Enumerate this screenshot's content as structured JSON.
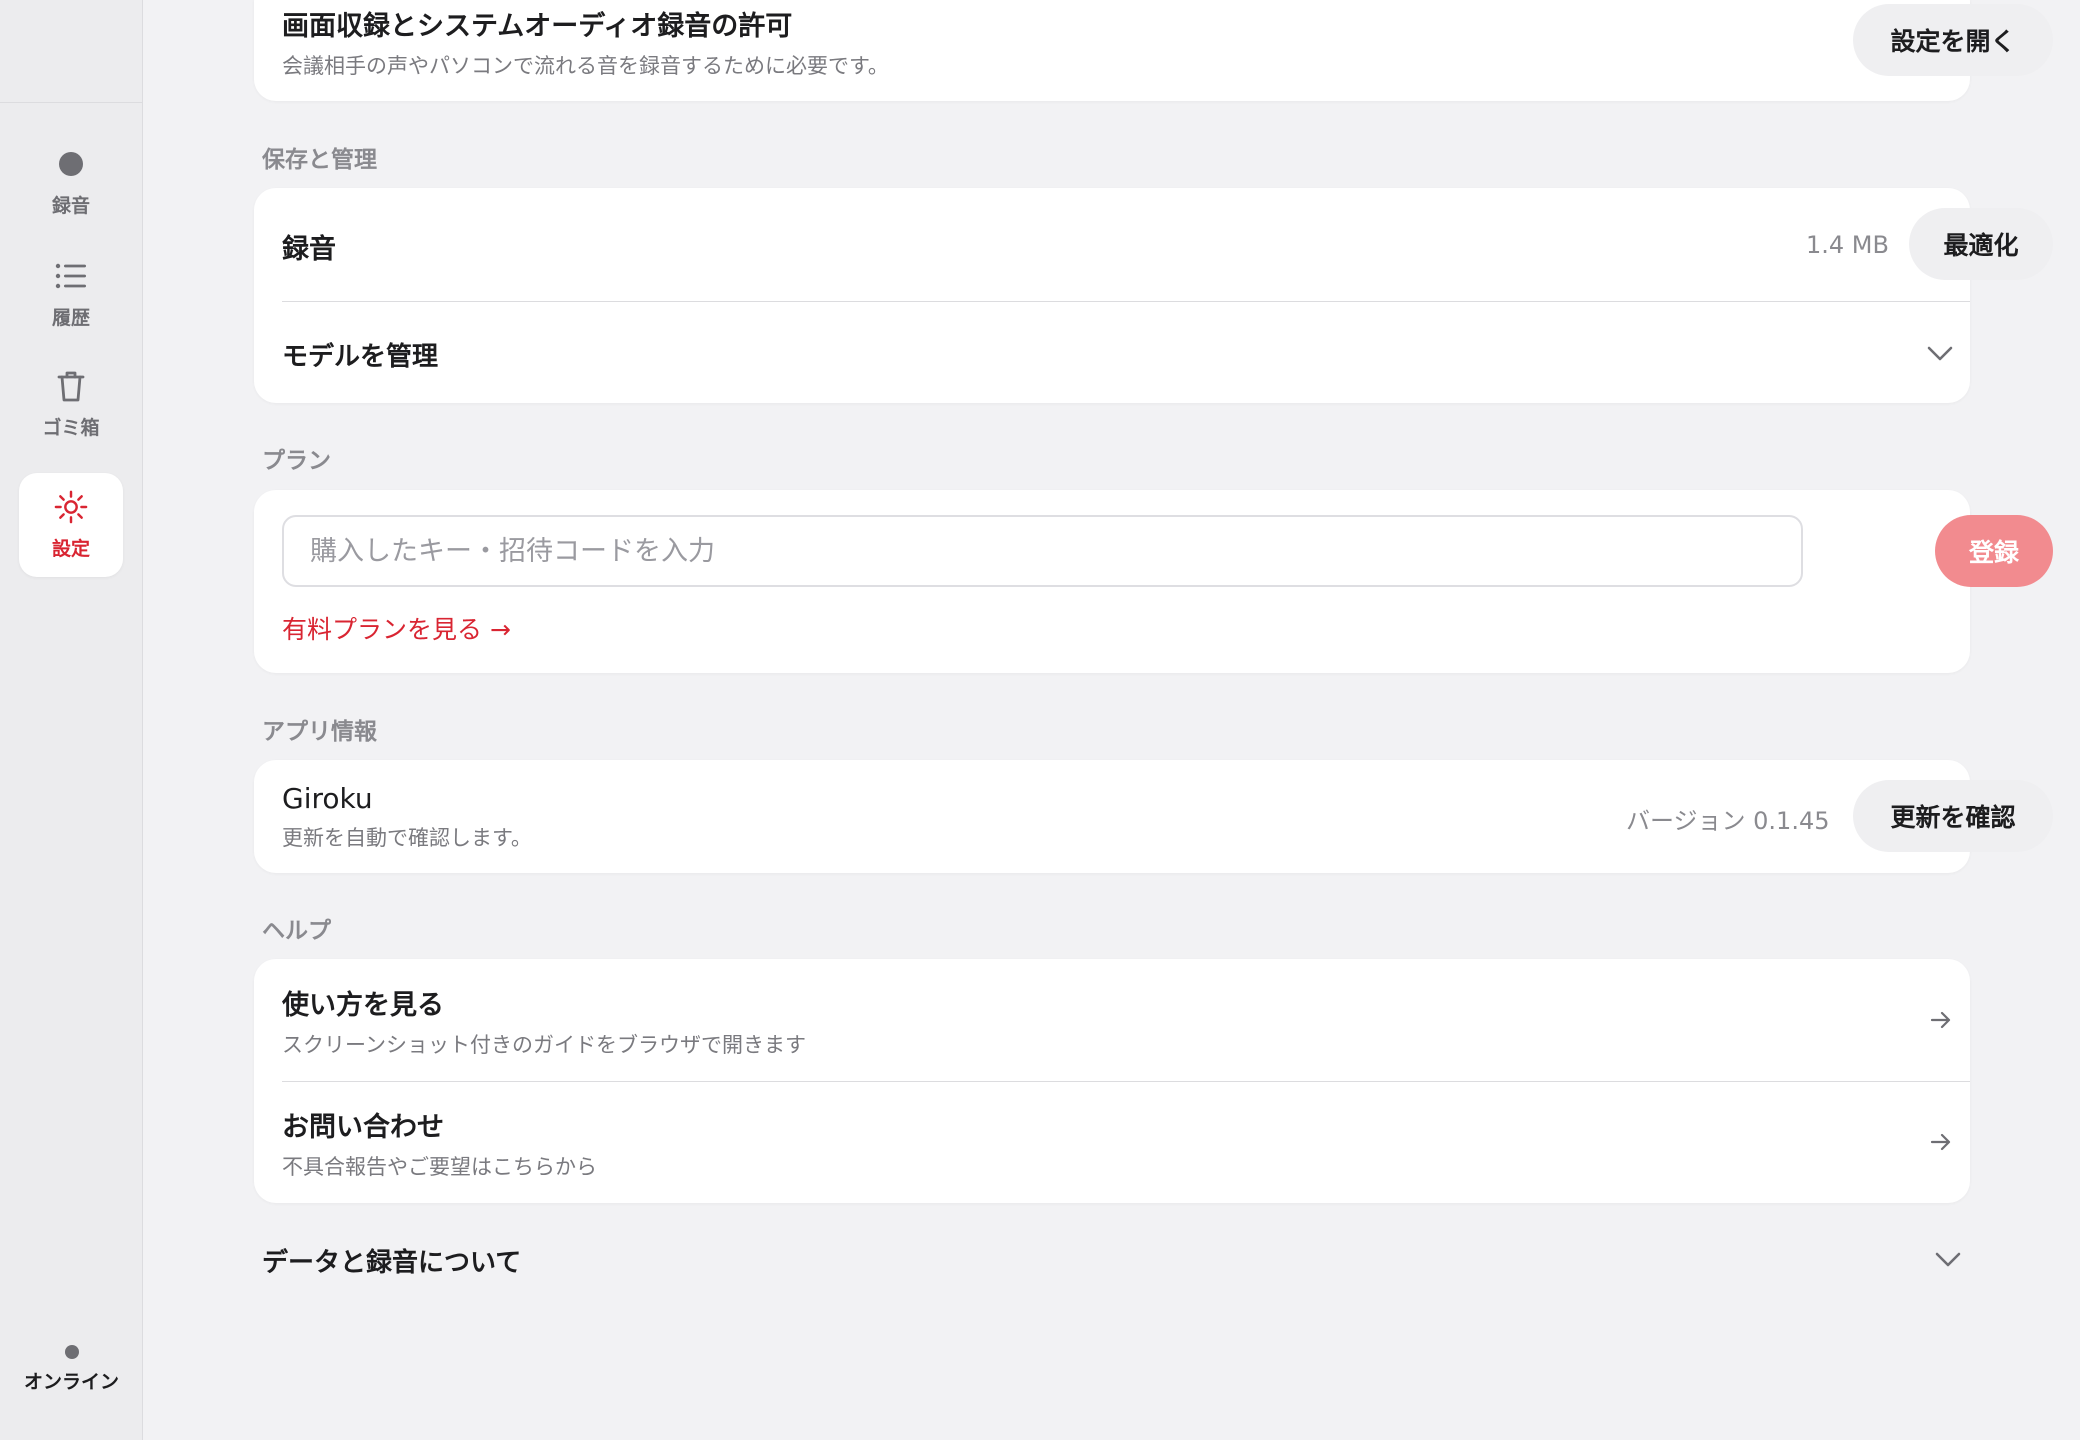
{
  "sidebar": {
    "items": [
      {
        "label": "録音",
        "icon": "record-dot-icon"
      },
      {
        "label": "履歴",
        "icon": "list-icon"
      },
      {
        "label": "ゴミ箱",
        "icon": "trash-icon"
      },
      {
        "label": "設定",
        "icon": "gear-icon",
        "active": true
      }
    ],
    "status": "オンライン"
  },
  "permission": {
    "title": "画面収録とシステムオーディオ録音の許可",
    "subtitle": "会議相手の声やパソコンで流れる音を録音するために必要です。",
    "button": "設定を開く"
  },
  "storage": {
    "section": "保存と管理",
    "recording_label": "録音",
    "recording_size": "1.4 MB",
    "optimize_button": "最適化",
    "models_label": "モデルを管理"
  },
  "plan": {
    "section": "プラン",
    "input_placeholder": "購入したキー・招待コードを入力",
    "register_button": "登録",
    "link": "有料プランを見る →"
  },
  "about": {
    "section": "アプリ情報",
    "app_name": "Giroku",
    "subtitle": "更新を自動で確認します。",
    "version": "バージョン 0.1.45",
    "check_button": "更新を確認"
  },
  "help": {
    "section": "ヘルプ",
    "items": [
      {
        "title": "使い方を見る",
        "subtitle": "スクリーンショット付きのガイドをブラウザで開きます"
      },
      {
        "title": "お問い合わせ",
        "subtitle": "不具合報告やご要望はこちらから"
      }
    ]
  },
  "data_section": {
    "title": "データと録音について"
  },
  "colors": {
    "accent": "#d92532",
    "register_bg": "#f28b8f",
    "background": "#f2f2f4"
  }
}
